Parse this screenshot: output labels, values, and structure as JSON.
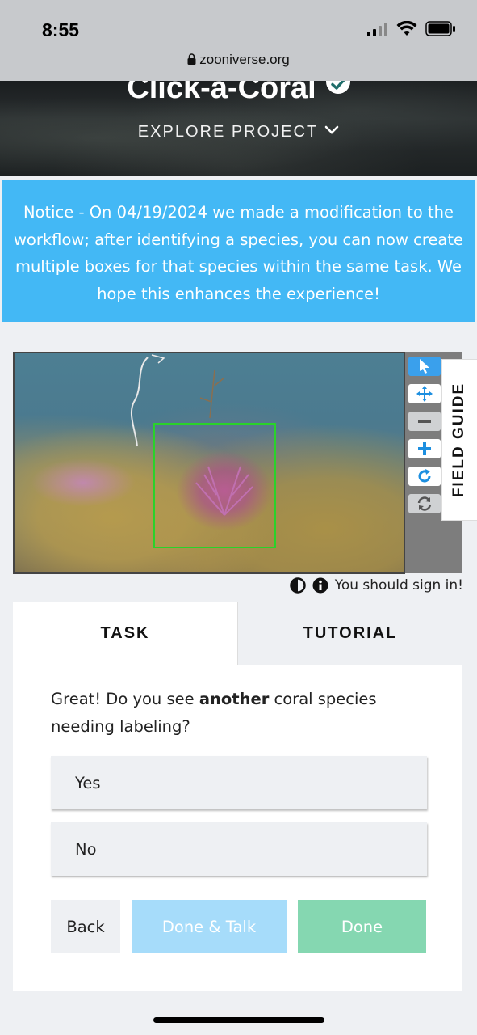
{
  "status_bar": {
    "time": "8:55",
    "url": "zooniverse.org"
  },
  "header": {
    "title": "Click-a-Coral",
    "explore_label": "EXPLORE PROJECT"
  },
  "notice": {
    "text": "Notice - On 04/19/2024 we made a modification to the workflow; after identifying a species, you can now create multiple boxes for that species within the same task. We hope this enhances the experience!"
  },
  "viewer": {
    "tools": [
      "pointer-icon",
      "move-icon",
      "zoom-out-icon",
      "zoom-in-icon",
      "rotate-icon",
      "reset-icon"
    ],
    "field_guide_label": "FIELD GUIDE",
    "sign_in_text": "You should sign in!",
    "bbox_color": "#2ad22a"
  },
  "task": {
    "tabs": [
      {
        "label": "TASK"
      },
      {
        "label": "TUTORIAL"
      }
    ],
    "question_prefix": "Great! Do you see ",
    "question_bold": "another",
    "question_suffix": " coral species needing labeling?",
    "answers": [
      {
        "label": "Yes"
      },
      {
        "label": "No"
      }
    ],
    "buttons": {
      "back": "Back",
      "done_talk": "Done & Talk",
      "done": "Done"
    }
  },
  "colors": {
    "notice_bg": "#43b8f5",
    "done_talk_bg": "#a6dcfa",
    "done_bg": "#85d7b1",
    "tool_active": "#3aa0ec"
  }
}
